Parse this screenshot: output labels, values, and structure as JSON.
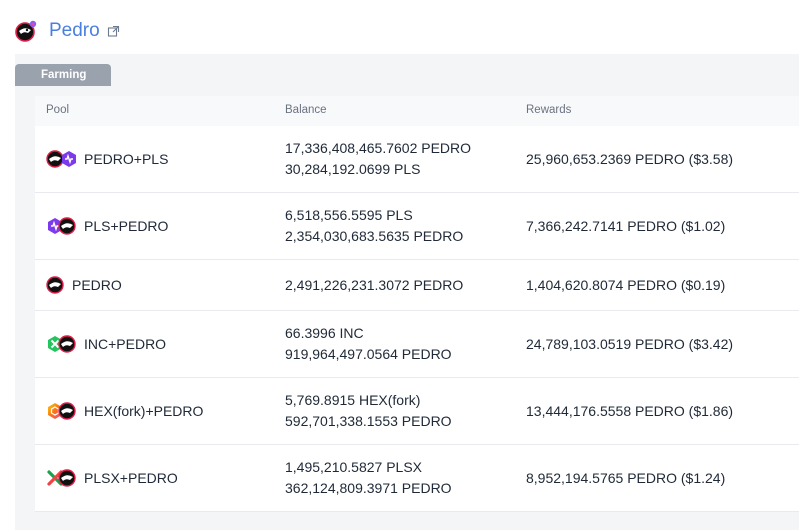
{
  "header": {
    "title": "Pedro"
  },
  "tabs": {
    "farming": "Farming"
  },
  "table": {
    "headers": {
      "pool": "Pool",
      "balance": "Balance",
      "rewards": "Rewards"
    },
    "rows": [
      {
        "pool": "PEDRO+PLS",
        "balance1": "17,336,408,465.7602 PEDRO",
        "balance2": "30,284,192.0699 PLS",
        "rewards": "25,960,653.2369 PEDRO ($3.58)"
      },
      {
        "pool": "PLS+PEDRO",
        "balance1": "6,518,556.5595 PLS",
        "balance2": "2,354,030,683.5635 PEDRO",
        "rewards": "7,366,242.7141 PEDRO ($1.02)"
      },
      {
        "pool": "PEDRO",
        "balance1": "2,491,226,231.3072 PEDRO",
        "balance2": "",
        "rewards": "1,404,620.8074 PEDRO ($0.19)"
      },
      {
        "pool": "INC+PEDRO",
        "balance1": "66.3996 INC",
        "balance2": "919,964,497.0564 PEDRO",
        "rewards": "24,789,103.0519 PEDRO ($3.42)"
      },
      {
        "pool": "HEX(fork)+PEDRO",
        "balance1": "5,769.8915 HEX(fork)",
        "balance2": "592,701,338.1553 PEDRO",
        "rewards": "13,444,176.5558 PEDRO ($1.86)"
      },
      {
        "pool": "PLSX+PEDRO",
        "balance1": "1,495,210.5827 PLSX",
        "balance2": "362,124,809.3971 PEDRO",
        "rewards": "8,952,194.5765 PEDRO ($1.24)"
      }
    ]
  },
  "colors": {
    "title": "#4a7fe0",
    "tab": "#9aa2ad",
    "pedro": "#e11d48",
    "pls": "#7c3aed",
    "inc": "#22c55e",
    "hex": "#f97316",
    "plsx_green": "#16a34a",
    "plsx_red": "#ef4444"
  },
  "icons": {
    "pedro": "pedro-icon",
    "pls": "pls-icon",
    "inc": "inc-icon",
    "hex": "hex-icon",
    "plsx": "plsx-icon",
    "external": "external-link-icon"
  }
}
